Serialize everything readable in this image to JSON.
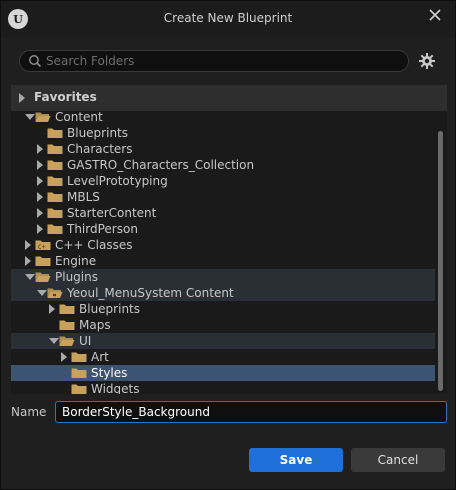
{
  "window": {
    "title": "Create New Blueprint",
    "logo_text": "U"
  },
  "search": {
    "placeholder": "Search Folders",
    "value": ""
  },
  "tree": {
    "favorites_label": "Favorites",
    "items": [
      {
        "label": "Content",
        "depth": 1,
        "expander": "down",
        "folder": "open",
        "state": "normal"
      },
      {
        "label": "Blueprints",
        "depth": 2,
        "expander": "none",
        "folder": "closed",
        "state": "normal"
      },
      {
        "label": "Characters",
        "depth": 2,
        "expander": "right",
        "folder": "closed",
        "state": "normal"
      },
      {
        "label": "GASTRO_Characters_Collection",
        "depth": 2,
        "expander": "right",
        "folder": "closed",
        "state": "normal"
      },
      {
        "label": "LevelPrototyping",
        "depth": 2,
        "expander": "right",
        "folder": "closed",
        "state": "normal"
      },
      {
        "label": "MBLS",
        "depth": 2,
        "expander": "right",
        "folder": "closed",
        "state": "normal"
      },
      {
        "label": "StarterContent",
        "depth": 2,
        "expander": "right",
        "folder": "closed",
        "state": "normal"
      },
      {
        "label": "ThirdPerson",
        "depth": 2,
        "expander": "right",
        "folder": "closed",
        "state": "normal"
      },
      {
        "label": "C++ Classes",
        "depth": 1,
        "expander": "right",
        "folder": "code",
        "state": "normal"
      },
      {
        "label": "Engine",
        "depth": 1,
        "expander": "right",
        "folder": "closed",
        "state": "normal"
      },
      {
        "label": "Plugins",
        "depth": 1,
        "expander": "down",
        "folder": "open",
        "state": "highlight"
      },
      {
        "label": "Yeoul_MenuSystem Content",
        "depth": 2,
        "expander": "down",
        "folder": "open-plugin",
        "state": "highlight"
      },
      {
        "label": "Blueprints",
        "depth": 3,
        "expander": "right",
        "folder": "closed",
        "state": "normal"
      },
      {
        "label": "Maps",
        "depth": 3,
        "expander": "none",
        "folder": "closed",
        "state": "normal"
      },
      {
        "label": "UI",
        "depth": 3,
        "expander": "down",
        "folder": "open",
        "state": "highlight"
      },
      {
        "label": "Art",
        "depth": 4,
        "expander": "right",
        "folder": "closed",
        "state": "normal"
      },
      {
        "label": "Styles",
        "depth": 4,
        "expander": "none",
        "folder": "closed",
        "state": "selected"
      },
      {
        "label": "Widgets",
        "depth": 4,
        "expander": "none",
        "folder": "closed",
        "state": "normal"
      }
    ]
  },
  "name_field": {
    "label": "Name",
    "value": "BorderStyle_Background"
  },
  "buttons": {
    "save_label": "Save",
    "cancel_label": "Cancel"
  },
  "icons": {
    "close": "close-icon",
    "search": "search-icon",
    "settings": "gear-icon",
    "folder": "folder-icon"
  },
  "colors": {
    "accent": "#1f6fd8",
    "selection": "#3c5372",
    "folder": "#c8a25a"
  }
}
